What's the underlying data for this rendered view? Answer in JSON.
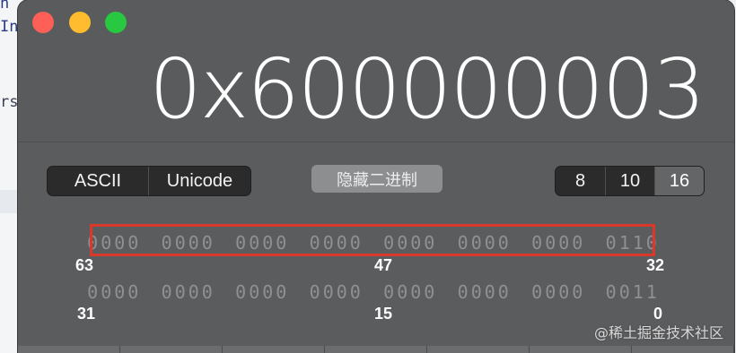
{
  "background_editor": {
    "lines": [
      "n",
      "In",
      "rs"
    ]
  },
  "calculator": {
    "display_value": "0x600000003",
    "encoding_tabs": [
      {
        "label": "ASCII",
        "selected": false
      },
      {
        "label": "Unicode",
        "selected": false
      }
    ],
    "hide_binary_button": "隐藏二进制",
    "base_tabs": [
      {
        "label": "8",
        "selected": false
      },
      {
        "label": "10",
        "selected": false
      },
      {
        "label": "16",
        "selected": true
      }
    ],
    "binary_rows": [
      {
        "nibbles": [
          "0000",
          "0000",
          "0000",
          "0000",
          "0000",
          "0000",
          "0000",
          "0110"
        ],
        "labels": {
          "high": "63",
          "mid": "47",
          "low": "32"
        }
      },
      {
        "nibbles": [
          "0000",
          "0000",
          "0000",
          "0000",
          "0000",
          "0000",
          "0000",
          "0011"
        ],
        "labels": {
          "high": "31",
          "mid": "15",
          "low": "0"
        }
      }
    ]
  },
  "watermark": "@稀土掘金技术社区",
  "colors": {
    "window_bg": "#5b5c5e",
    "segment_bg": "#2b2b2c",
    "selected_segment": "#646567",
    "highlight_border": "#d9382a",
    "close": "#fe5f57",
    "minimize": "#febc2e",
    "maximize": "#28c840"
  }
}
